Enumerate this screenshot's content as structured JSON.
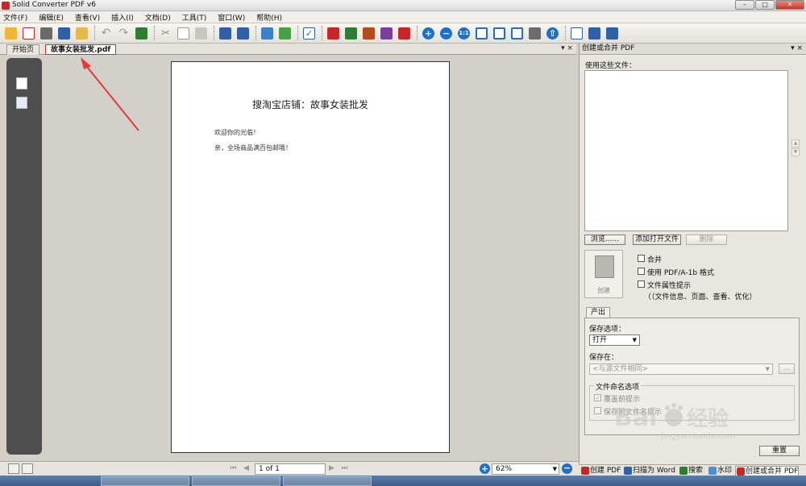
{
  "window": {
    "title": "Solid Converter PDF v6"
  },
  "menu": [
    "文件(F)",
    "编辑(E)",
    "查看(V)",
    "插入(I)",
    "文档(D)",
    "工具(T)",
    "窗口(W)",
    "帮助(H)"
  ],
  "doc_tabs": {
    "start": "开始页",
    "active": "故事女装批发.pdf",
    "controls": "▾ ×"
  },
  "document": {
    "title": "搜淘宝店铺：故事女装批发",
    "lines": [
      "欢迎你的光临！",
      "亲，全场商品满百包邮哦！"
    ]
  },
  "status": {
    "page": "1 of 1",
    "zoom": "62%"
  },
  "right_panel": {
    "title": "创建或合并 PDF",
    "controls": "▾ ×",
    "use_files_label": "使用这些文件：",
    "browse": "浏览......",
    "add_open": "添加打开文件",
    "remove": "删除",
    "create": "创建",
    "options": [
      "合并",
      "使用 PDF/A-1b 格式",
      "文件属性提示"
    ],
    "options_note": "（（文件信息、页面、查看、优化）",
    "output_tab": "产出",
    "save_option_label": "保存选项：",
    "save_option_value": "打开",
    "save_in_label": "保存在：",
    "save_in_value": "<与源文件相同>",
    "browse_small": "...",
    "naming_label": "文件命名选项",
    "naming_options": [
      "覆盖前提示",
      "保存前文件名提示"
    ],
    "reset": "重置"
  },
  "bottom_tabs": [
    "创建 PDF",
    "扫描为 Word",
    "搜索",
    "水印",
    "创建或合并 PDF"
  ],
  "icons": {
    "toolbar": [
      "open-icon",
      "new-icon",
      "save-icon",
      "print-icon",
      "email-icon",
      "undo-icon",
      "redo-icon",
      "convert-icon",
      "cut-icon",
      "copy-icon",
      "paste-icon",
      "columns-icon",
      "rows-icon",
      "extract-icon",
      "export-icon",
      "checkbox-icon",
      "convert-word-icon",
      "convert-excel-icon",
      "convert-ppt-icon",
      "convert-html-icon",
      "convert-text-icon",
      "zoom-in-icon",
      "zoom-out-icon",
      "actual-size-icon",
      "fit-width-icon",
      "fit-page-icon",
      "fullscreen-icon",
      "tool-icon",
      "up-icon",
      "single-page-icon",
      "grid-icon",
      "layout-icon"
    ]
  },
  "colors": {
    "accent_red": "#d32f2f",
    "zoom_blue": "#1e6fc9",
    "panel_bg": "#e8e6de",
    "workspace_bg": "#d2d0c9"
  },
  "watermark": {
    "brand": "Bai",
    "brand_cn": "经验",
    "url": "jingyan.baidu.com"
  }
}
